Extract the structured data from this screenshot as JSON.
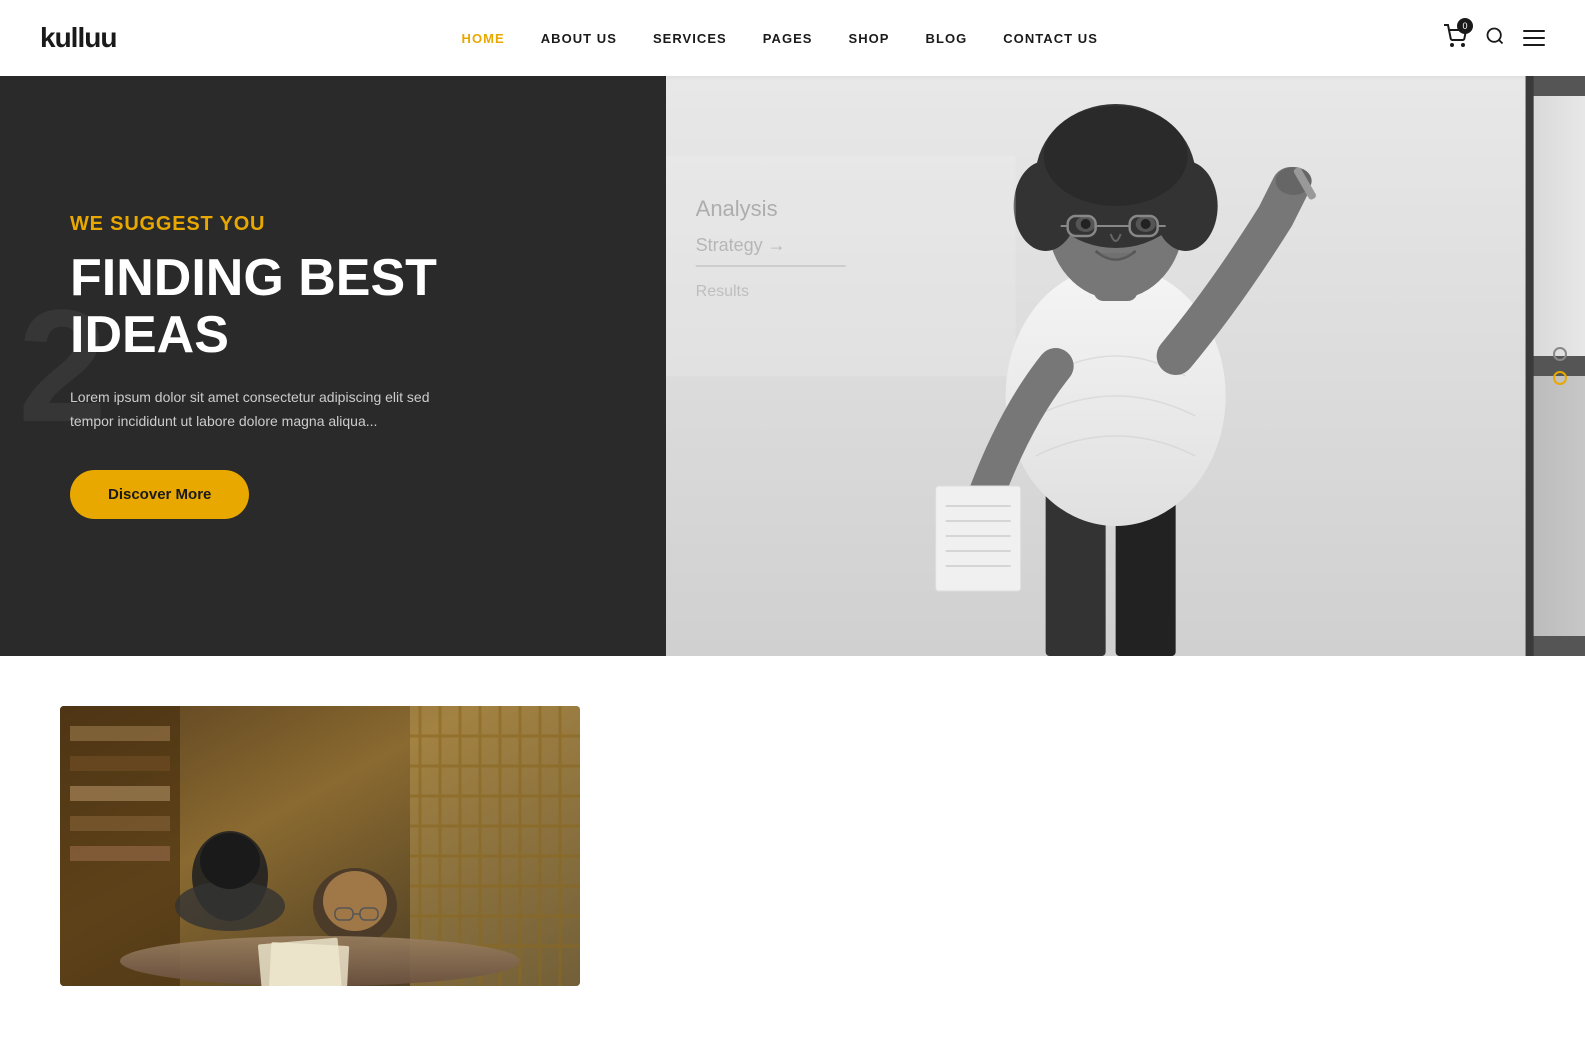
{
  "header": {
    "logo": "kulluu",
    "nav": [
      {
        "label": "HOME",
        "active": true
      },
      {
        "label": "ABOUT US",
        "active": false
      },
      {
        "label": "SERVICES",
        "active": false
      },
      {
        "label": "PAGES",
        "active": false
      },
      {
        "label": "SHOP",
        "active": false
      },
      {
        "label": "BLOG",
        "active": false
      },
      {
        "label": "CONTACT US",
        "active": false
      }
    ],
    "cart_count": "0"
  },
  "hero": {
    "slide_number": "2",
    "subtitle": "WE SUGGEST YOU",
    "title": "FINDING BEST IDEAS",
    "description": "Lorem ipsum dolor sit amet consectetur adipiscing elit sed tempor incididunt ut labore dolore magna aliqua...",
    "cta_label": "Discover More",
    "dots": [
      {
        "active": false
      },
      {
        "active": true
      }
    ]
  },
  "below_hero": {
    "image_alt": "Two women studying together"
  },
  "colors": {
    "accent": "#e8a800",
    "dark_bg": "#2a2a2a",
    "text_light": "#cccccc",
    "text_dark": "#1a1a1a"
  },
  "icons": {
    "cart": "🛒",
    "search": "🔍",
    "menu": "☰"
  }
}
